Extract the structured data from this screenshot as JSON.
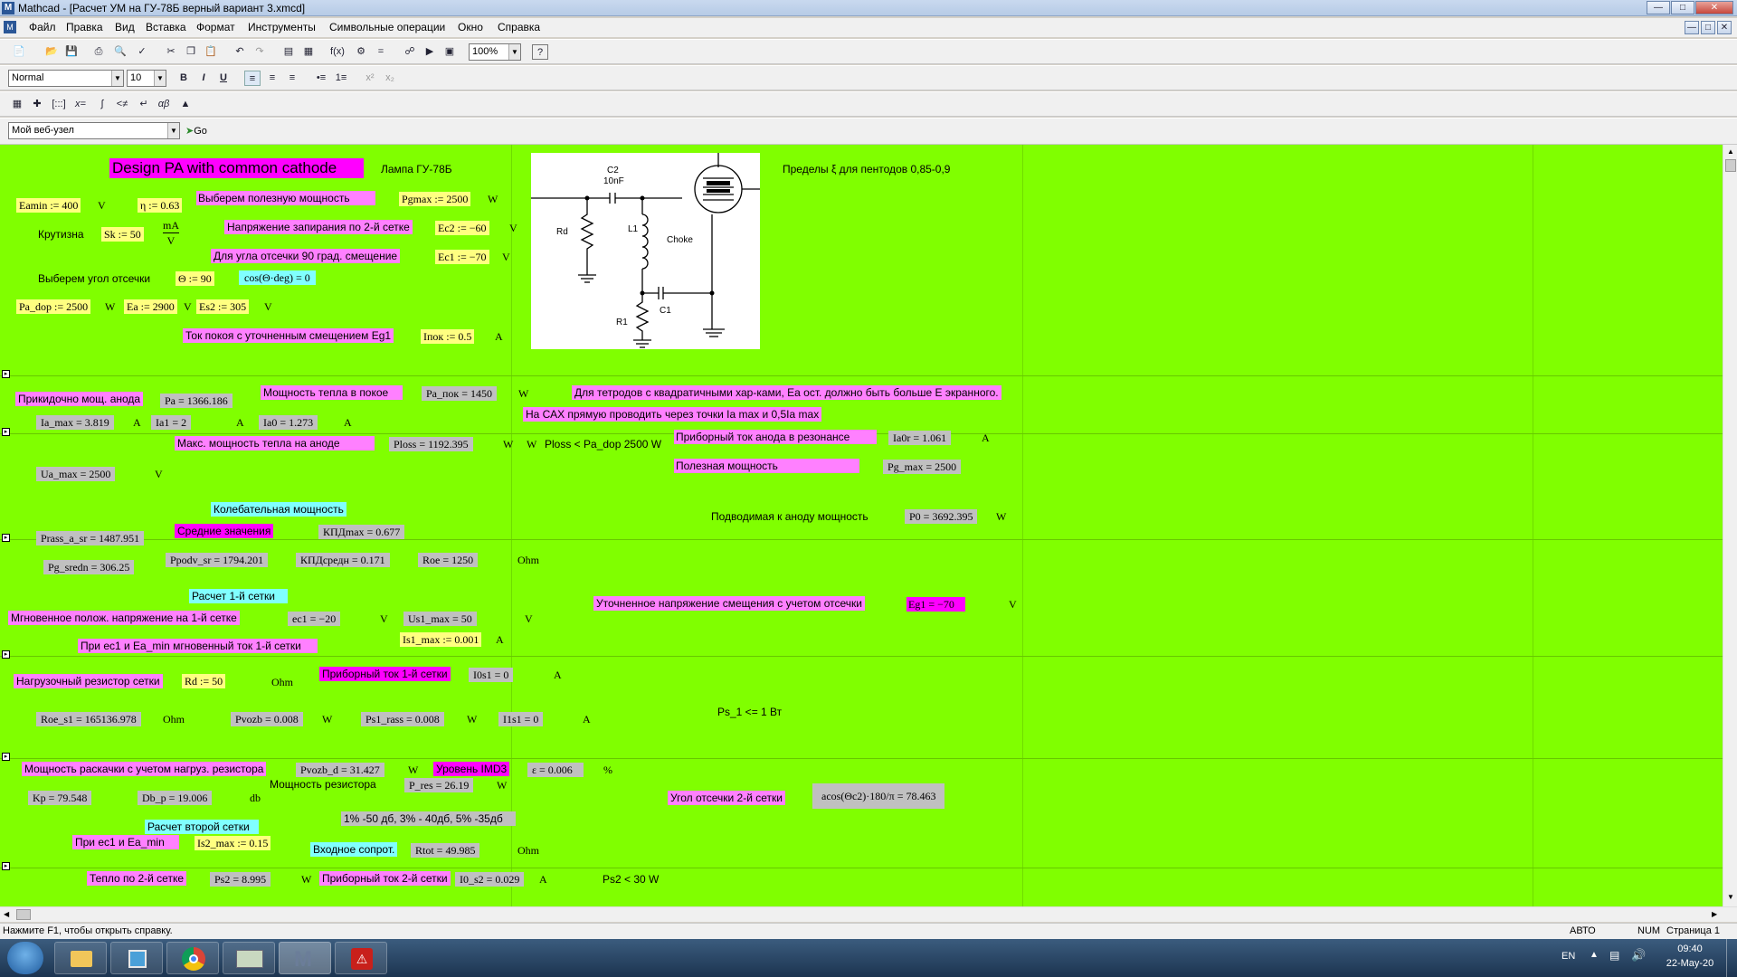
{
  "window": {
    "title": "Mathcad - [Расчет УМ на ГУ-78Б  верный вариант 3.xmcd]",
    "app_icon": "M"
  },
  "menu": [
    "Файл",
    "Правка",
    "Вид",
    "Вставка",
    "Формат",
    "Инструменты",
    "Символьные операции",
    "Окно",
    "Справка"
  ],
  "toolbar": {
    "zoom": "100%",
    "style": "Normal",
    "font_size": "10",
    "bold": "B",
    "italic": "I",
    "underline": "U",
    "url_combo": "Мой веб-узел",
    "go": "Go"
  },
  "sheet": {
    "title": "Design PA with common cathode",
    "tube": "Лампа ГУ-78Б",
    "xi_limits": "Пределы ξ для пентодов  0,85-0,9",
    "r": {
      "eamin": "Eamin := 400",
      "unit_V": "V",
      "eta": "η := 0.63",
      "select_power": "Выберем полезную мощность",
      "pgmax": "Pgmax := 2500",
      "unit_W": "W",
      "steepness": "Крутизна",
      "sk": "Sk := 50",
      "ma": "mA",
      "v": "V",
      "cutoff_g2": "Напряжение запирания по 2-й сетке",
      "ec2": "Ec2 := −60",
      "bias90": "Для угла отсечки 90 град. смещение",
      "ec1": "Ec1 := −70",
      "select_angle": "Выберем угол отсечки",
      "theta": "Θ := 90",
      "cos": "cos(Θ·deg) = 0",
      "pa_dop": "Pa_dop := 2500",
      "ea": "Ea := 2900",
      "es2": "Es2 := 305",
      "idle_current": "Ток покоя с уточненным смещением Eg1",
      "inok": "Iпок := 0.5",
      "unit_A": "A",
      "approx_power": "Прикидочно мощ. анода",
      "pa": "Pa = 1366.186",
      "idle_heat": "Мощность тепла в покое",
      "pa_pok": "Pa_пок = 1450",
      "tetrode_note": "Для тетродов с квадратичными хар-ками, Ea ост. должно быть больше E экранного.",
      "cax_note": "На САХ прямую проводить через точки Ia max  и 0,5Ia max",
      "ia_max": "Ia_max = 3.819",
      "ia1": "Ia1 = 2",
      "ia0": "Ia0 = 1.273",
      "max_heat": "Макс. мощность тепла на аноде",
      "ploss": "Ploss = 1192.395",
      "ploss_cmp": "Ploss < Pa_dop 2500 W",
      "res_current": "Приборный ток анода  в резонансе",
      "ia0r": "Ia0r = 1.061",
      "useful_power": "Полезная мощность",
      "pg_max": "Pg_max = 2500",
      "ua_max": "Ua_max = 2500",
      "osc_power": "Колебательная мощность",
      "supplied_power": "Подводимая к аноду мощность",
      "p0": "P0 = 3692.395",
      "prass": "Prass_a_sr = 1487.951",
      "avg": "Средние значения",
      "kpd_max": "КПДmax = 0.677",
      "pg_sredn": "Pg_sredn = 306.25",
      "ppodv": "Ppodv_sr = 1794.201",
      "kpd_sr": "КПДсредн = 0.171",
      "roe": "Roe = 1250",
      "unit_ohm": "Ohm",
      "g1_calc": "Расчет 1-й сетки",
      "inst_voltage": "Мгновенное полож. напряжение на 1-й сетке",
      "ec1v": "ec1 = −20",
      "us1": "Us1_max = 50",
      "refined_bias": "Уточненное напряжение смещения с учетом отсечки",
      "eg1": "Eg1 = −70",
      "inst_current": "При ec1  и Ea_min мгновенный ток 1-й сетки",
      "is1": "Is1_max := 0.001",
      "load_res": "Нагрузочный резистор сетки",
      "rd": "Rd := 50",
      "g1_current": "Приборный ток 1-й сетки",
      "i0s1": "I0s1 = 0",
      "roe_s1": "Roe_s1 = 165136.978",
      "pvozb": "Pvozb = 0.008",
      "ps1": "Ps1_rass = 0.008",
      "i1s1": "I1s1 = 0",
      "ps1_note": "Ps_1 <= 1 Вт",
      "drive_power": "Мощность раскачки с учетом нагруз. резистора",
      "pvozb_d": "Pvozb_d = 31.427",
      "imd3": "Уровень IMD3",
      "eps": "ε = 0.006",
      "pct": "%",
      "res_power": "Мощность резистора",
      "p_res": "P_res = 26.19",
      "g2_angle": "Угол отсечки 2-й сетки",
      "acos": "acos(Θc2)·180/π = 78.463",
      "kp": "Kp = 79.548",
      "db": "Db_p = 19.006",
      "db_unit": "db",
      "imd_note": "1% -50 дб, 3% - 40дб, 5% -35дб",
      "g2_calc": "Расчет второй сетки",
      "at_ec1": "При ec1 и Ea_min",
      "is2": "Is2_max := 0.15",
      "input_res": "Входное сопрот.",
      "rtot": "Rtot = 49.985",
      "g2_heat": "Тепло по 2-й сетке",
      "ps2": "Ps2 = 8.995",
      "g2_current": "Приборный ток 2-й сетки",
      "i0_s2": "I0_s2 = 0.029",
      "ps2_note": "Ps2 < 30 W"
    },
    "schematic": {
      "c2": "C2",
      "c2v": "10nF",
      "rd": "Rd",
      "l1": "L1",
      "choke": "Choke",
      "r1": "R1",
      "c1": "C1"
    }
  },
  "status": {
    "hint": "Нажмите F1, чтобы открыть справку.",
    "auto": "АВТО",
    "num": "NUM",
    "page": "Страница 1"
  },
  "taskbar": {
    "lang": "EN",
    "time": "09:40",
    "date": "22-May-20"
  }
}
